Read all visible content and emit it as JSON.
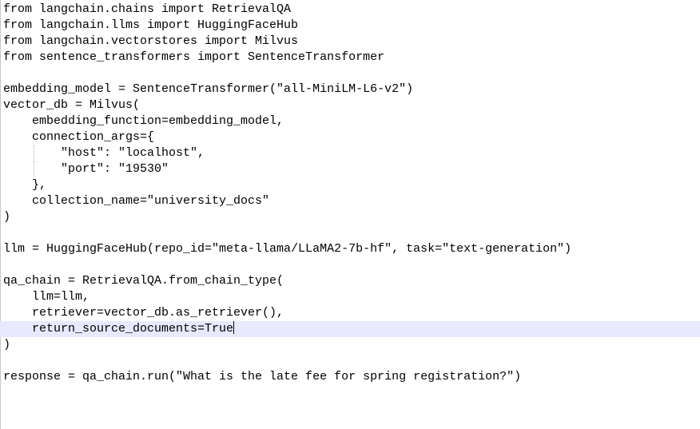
{
  "editor": {
    "active_line": 20,
    "lines": [
      "from langchain.chains import RetrievalQA",
      "from langchain.llms import HuggingFaceHub",
      "from langchain.vectorstores import Milvus",
      "from sentence_transformers import SentenceTransformer",
      "",
      "embedding_model = SentenceTransformer(\"all-MiniLM-L6-v2\")",
      "vector_db = Milvus(",
      "    embedding_function=embedding_model,",
      "    connection_args={",
      "        \"host\": \"localhost\",",
      "        \"port\": \"19530\"",
      "    },",
      "    collection_name=\"university_docs\"",
      ")",
      "",
      "llm = HuggingFaceHub(repo_id=\"meta-llama/LLaMA2-7b-hf\", task=\"text-generation\")",
      "",
      "qa_chain = RetrievalQA.from_chain_type(",
      "    llm=llm,",
      "    retriever=vector_db.as_retriever(),",
      "    return_source_documents=True",
      ")",
      "",
      "response = qa_chain.run(\"What is the late fee for spring registration?\")"
    ]
  }
}
